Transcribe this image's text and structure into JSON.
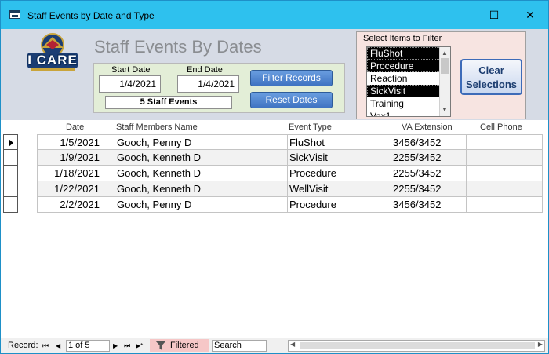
{
  "window": {
    "title": "Staff Events by Date and Type",
    "minimize_glyph": "—",
    "maximize_glyph": "☐",
    "close_glyph": "✕"
  },
  "header": {
    "logo_text": "I CARE",
    "form_title": "Staff Events By Dates",
    "start_date_label": "Start Date",
    "end_date_label": "End Date",
    "start_date_value": "1/4/2021",
    "end_date_value": "1/4/2021",
    "staff_events_count": "5 Staff Events",
    "filter_records_label": "Filter Records",
    "reset_dates_label": "Reset Dates"
  },
  "filter": {
    "label": "Select Items to Filter",
    "items": [
      {
        "label": "FluShot",
        "selected": true
      },
      {
        "label": "Procedure",
        "selected": true
      },
      {
        "label": "Reaction",
        "selected": false
      },
      {
        "label": "SickVisit",
        "selected": true
      },
      {
        "label": "Training",
        "selected": false
      },
      {
        "label": "Vax1",
        "selected": false
      }
    ],
    "clear_button_label": "Clear Selections"
  },
  "table": {
    "columns": [
      "Date",
      "Staff Members Name",
      "Event Type",
      "VA Extension",
      "Cell Phone"
    ],
    "rows": [
      {
        "date": "1/5/2021",
        "name": "Gooch, Penny D",
        "event": "FluShot",
        "ext": "3456/3452",
        "cell": ""
      },
      {
        "date": "1/9/2021",
        "name": "Gooch, Kenneth D",
        "event": "SickVisit",
        "ext": "2255/3452",
        "cell": ""
      },
      {
        "date": "1/18/2021",
        "name": "Gooch, Kenneth D",
        "event": "Procedure",
        "ext": "2255/3452",
        "cell": ""
      },
      {
        "date": "1/22/2021",
        "name": "Gooch, Kenneth D",
        "event": "WellVisit",
        "ext": "2255/3452",
        "cell": ""
      },
      {
        "date": "2/2/2021",
        "name": "Gooch, Penny D",
        "event": "Procedure",
        "ext": "3456/3452",
        "cell": ""
      }
    ]
  },
  "statusbar": {
    "record_label": "Record:",
    "first_glyph": "⏮",
    "prev_glyph": "◀",
    "position": "1 of 5",
    "next_glyph": "▶",
    "last_glyph": "⏭",
    "new_glyph": "▶*",
    "filtered_label": "Filtered",
    "search_label": "Search"
  }
}
